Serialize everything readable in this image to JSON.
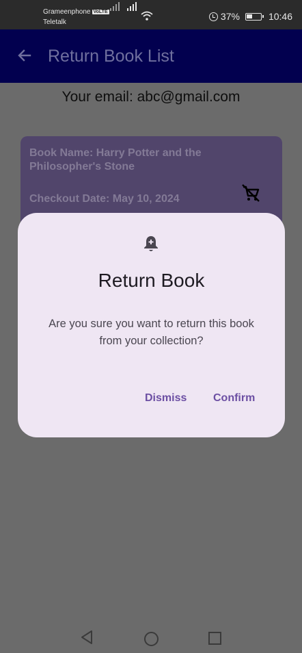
{
  "status_bar": {
    "carrier_1": "Grameenphone",
    "volte_badge": "VoLTE",
    "carrier_2": "Teletalk",
    "battery_percent": "37%",
    "time": "10:46"
  },
  "app_bar": {
    "title": "Return Book List"
  },
  "user": {
    "email_line": "Your email: abc@gmail.com"
  },
  "book_card": {
    "name": "Book Name: Harry Potter and the Philosopher's Stone",
    "checkout": "Checkout Date: May 10, 2024"
  },
  "dialog": {
    "title": "Return Book",
    "message": "Are you sure you want to return this book from your collection?",
    "dismiss_label": "Dismiss",
    "confirm_label": "Confirm"
  },
  "colors": {
    "app_bar": "#02004f",
    "dialog_bg": "#efe6f3",
    "accent": "#6c4fa3"
  }
}
